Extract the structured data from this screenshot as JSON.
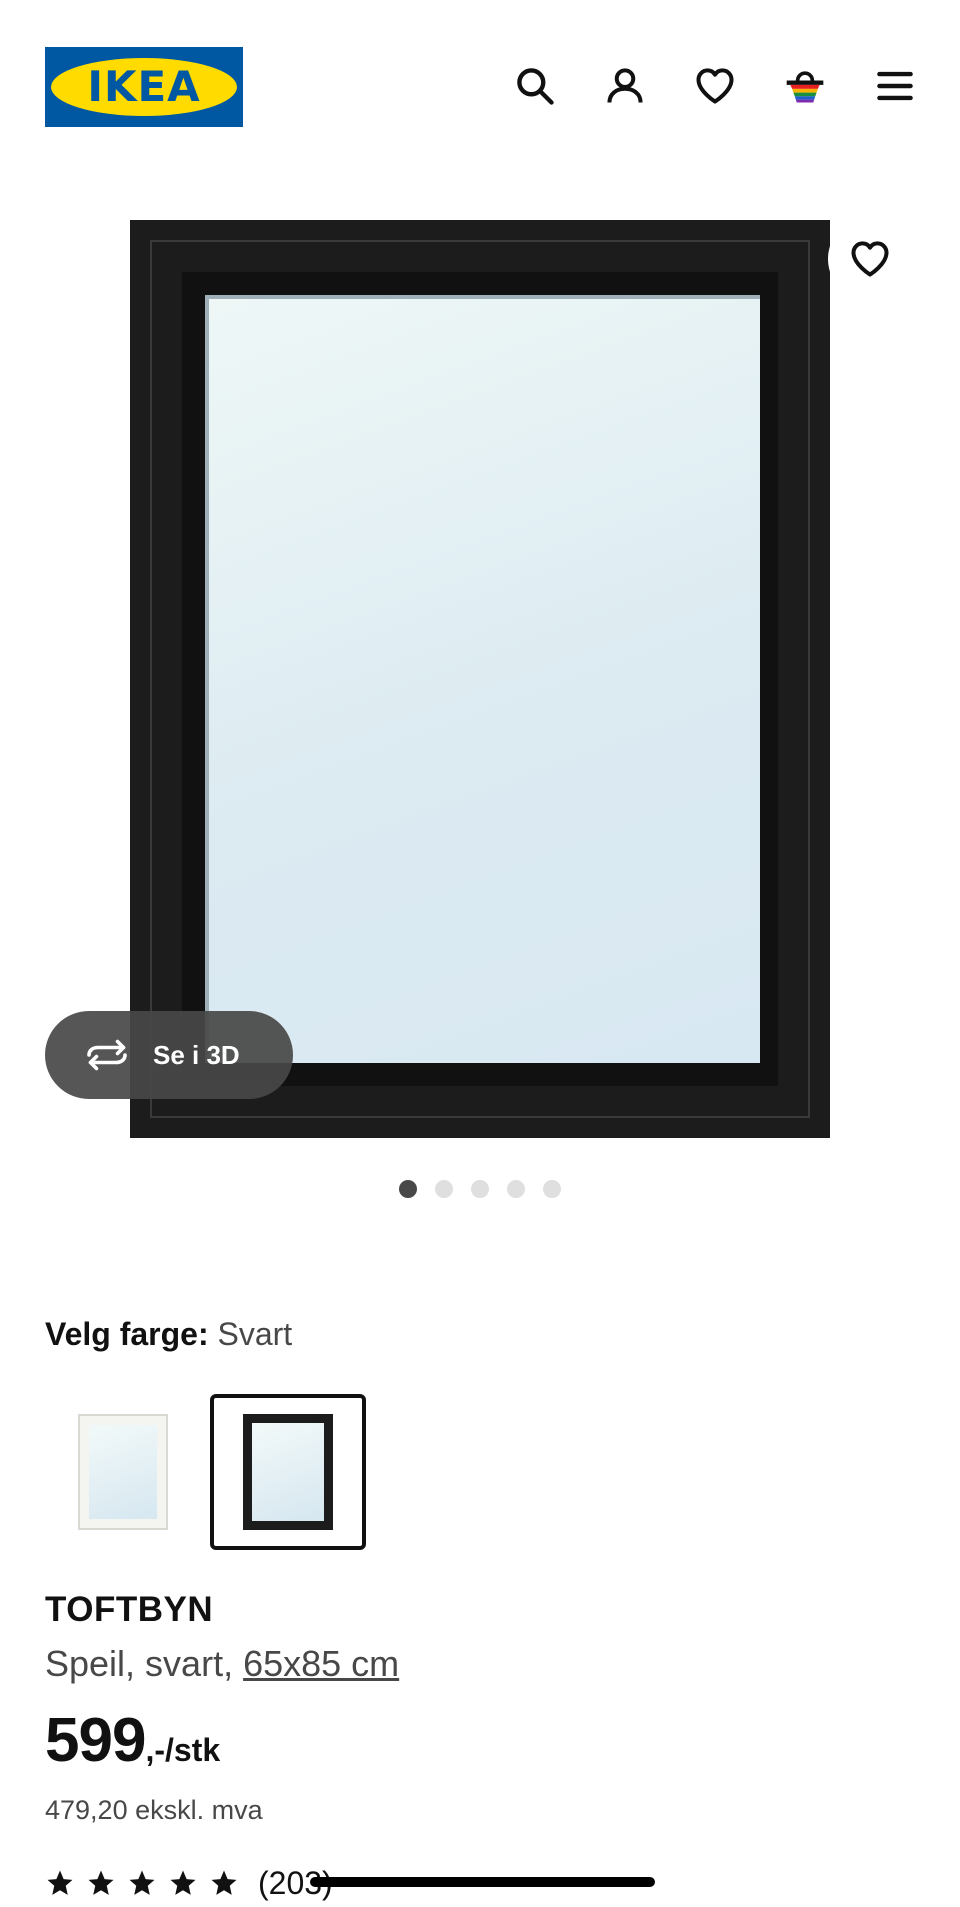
{
  "header": {
    "logo_text": "IKEA",
    "icons": [
      "search-icon",
      "account-icon",
      "heart-icon",
      "basket-icon",
      "menu-icon"
    ]
  },
  "media": {
    "view_3d_label": "Se i 3D",
    "image_count": 5,
    "active_image": 1
  },
  "color_picker": {
    "label": "Velg farge:",
    "selected_value": "Svart",
    "options": [
      "Hvit",
      "Svart"
    ]
  },
  "product": {
    "name": "TOFTBYN",
    "description_prefix": "Speil, svart,",
    "size": "65x85 cm",
    "price_main": "599",
    "price_suffix": ",-/stk",
    "price_ex_vat": "479,20 ekskl. mva",
    "rating_stars": 5,
    "review_count": "(203)"
  },
  "colors": {
    "ikea_blue": "#0058a3",
    "ikea_yellow": "#ffdb00",
    "text_primary": "#111111",
    "text_secondary": "#484848"
  }
}
